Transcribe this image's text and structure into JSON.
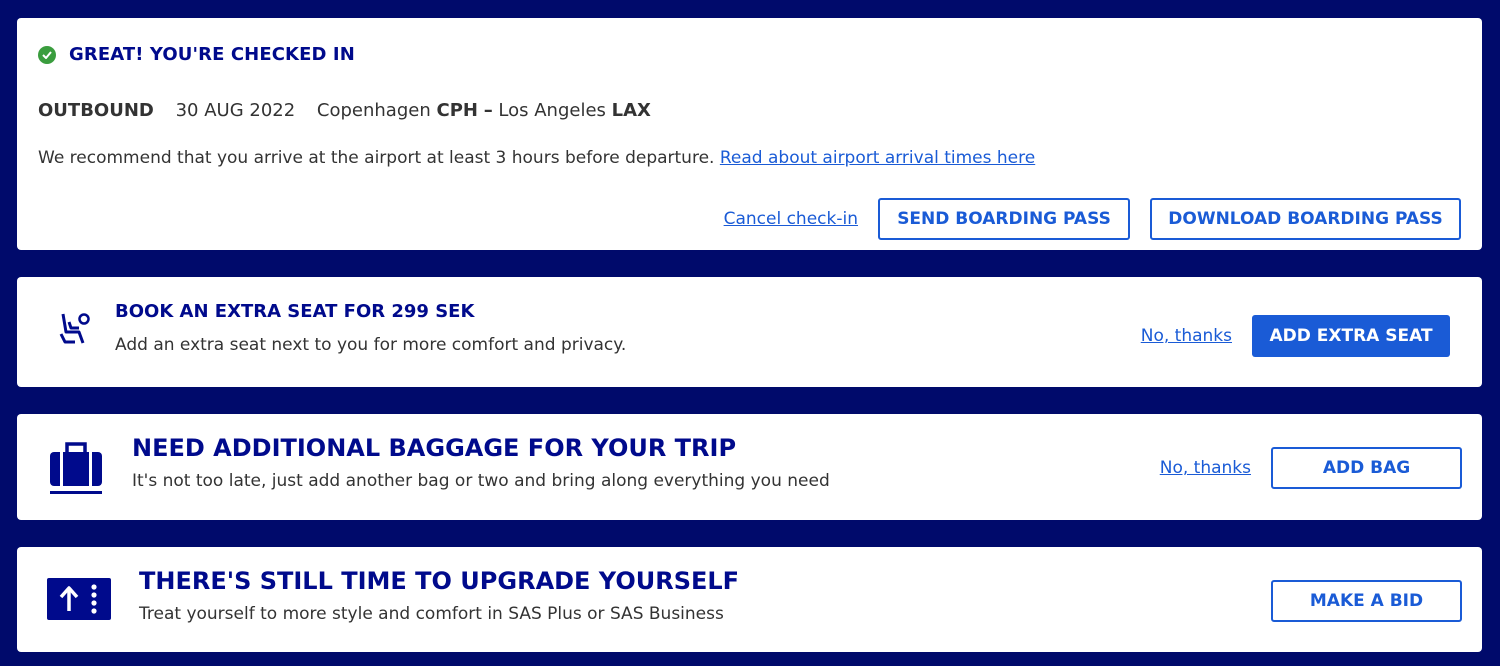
{
  "checkin": {
    "status_title": "GREAT! YOU'RE CHECKED IN",
    "direction": "OUTBOUND",
    "date": "30 AUG 2022",
    "origin_city": "Copenhagen",
    "origin_code": "CPH",
    "separator": "–",
    "destination_city": "Los Angeles",
    "destination_code": "LAX",
    "recommendation": "We recommend that you arrive at the airport at least 3 hours before departure.",
    "arrival_link": "Read about airport arrival times here",
    "cancel_link": "Cancel check-in",
    "send_label": "SEND BOARDING PASS",
    "download_label": "DOWNLOAD BOARDING PASS"
  },
  "extra_seat": {
    "icon": "seat-icon",
    "title": "BOOK AN EXTRA SEAT FOR 299 SEK",
    "description": "Add an extra seat next to you for more comfort and privacy.",
    "decline": "No, thanks",
    "action": "ADD EXTRA SEAT"
  },
  "baggage": {
    "icon": "suitcase-icon",
    "title": "NEED ADDITIONAL BAGGAGE FOR YOUR TRIP",
    "description": "It's not too late, just add another bag or two and bring along everything you need",
    "decline": "No, thanks",
    "action": "ADD BAG"
  },
  "upgrade": {
    "icon": "upgrade-ticket-icon",
    "title": "THERE'S STILL TIME TO UPGRADE YOURSELF",
    "description": "Treat yourself to more style and comfort in SAS Plus or SAS Business",
    "action": "MAKE A BID"
  },
  "colors": {
    "background": "#000A6B",
    "heading": "#000A8C",
    "accent": "#1a5bd6",
    "success": "#3a9d3e"
  }
}
